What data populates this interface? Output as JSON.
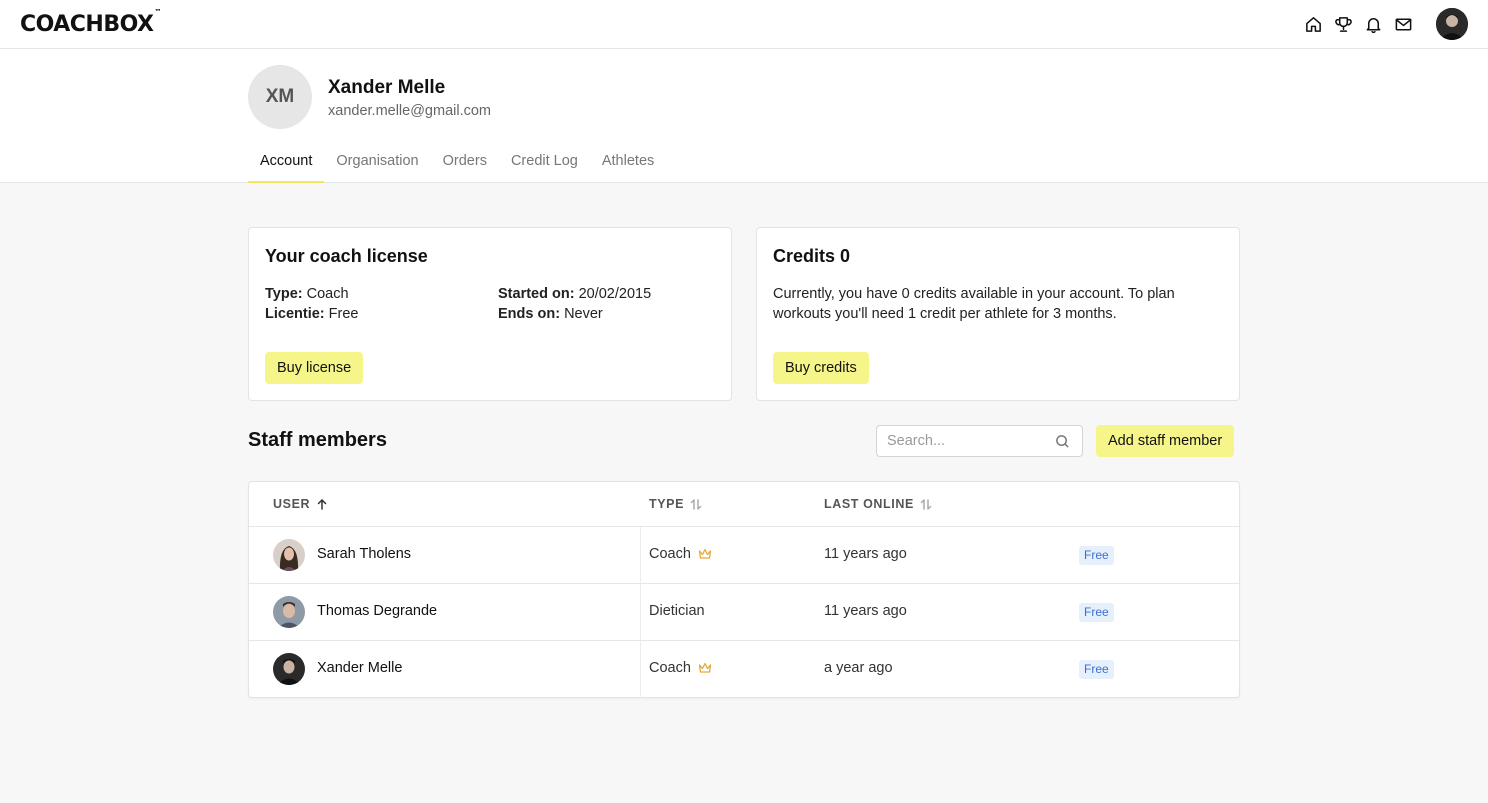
{
  "app": {
    "logo": "COACHBOX",
    "logo_tm": "™"
  },
  "topnav": {
    "icons": [
      "home-icon",
      "trophy-icon",
      "bell-icon",
      "mail-icon"
    ]
  },
  "profile": {
    "initials": "XM",
    "name": "Xander Melle",
    "email": "xander.melle@gmail.com",
    "tabs": [
      {
        "label": "Account",
        "active": true
      },
      {
        "label": "Organisation",
        "active": false
      },
      {
        "label": "Orders",
        "active": false
      },
      {
        "label": "Credit Log",
        "active": false
      },
      {
        "label": "Athletes",
        "active": false
      }
    ]
  },
  "license_card": {
    "title": "Your coach license",
    "type_label": "Type:",
    "type_value": "Coach",
    "licentie_label": "Licentie:",
    "licentie_value": "Free",
    "started_label": "Started on:",
    "started_value": "20/02/2015",
    "ends_label": "Ends on:",
    "ends_value": "Never",
    "button": "Buy license"
  },
  "credits_card": {
    "title": "Credits 0",
    "text": "Currently, you have 0 credits available in your account. To plan workouts you'll need 1 credit per athlete for 3 months.",
    "button": "Buy credits"
  },
  "staff": {
    "title": "Staff members",
    "search_placeholder": "Search...",
    "add_button": "Add staff member",
    "columns": {
      "user": "USER",
      "type": "TYPE",
      "last_online": "LAST ONLINE"
    },
    "rows": [
      {
        "name": "Sarah Tholens",
        "type": "Coach",
        "crown": true,
        "last_online": "11 years ago",
        "badge": "Free"
      },
      {
        "name": "Thomas Degrande",
        "type": "Dietician",
        "crown": false,
        "last_online": "11 years ago",
        "badge": "Free"
      },
      {
        "name": "Xander Melle",
        "type": "Coach",
        "crown": true,
        "last_online": "a year ago",
        "badge": "Free"
      }
    ]
  },
  "colors": {
    "accent_yellow": "#f6f58a",
    "tab_underline": "#f1e95a",
    "badge_bg": "#e6effc",
    "badge_text": "#3c6fd1",
    "crown": "#e8a838"
  }
}
